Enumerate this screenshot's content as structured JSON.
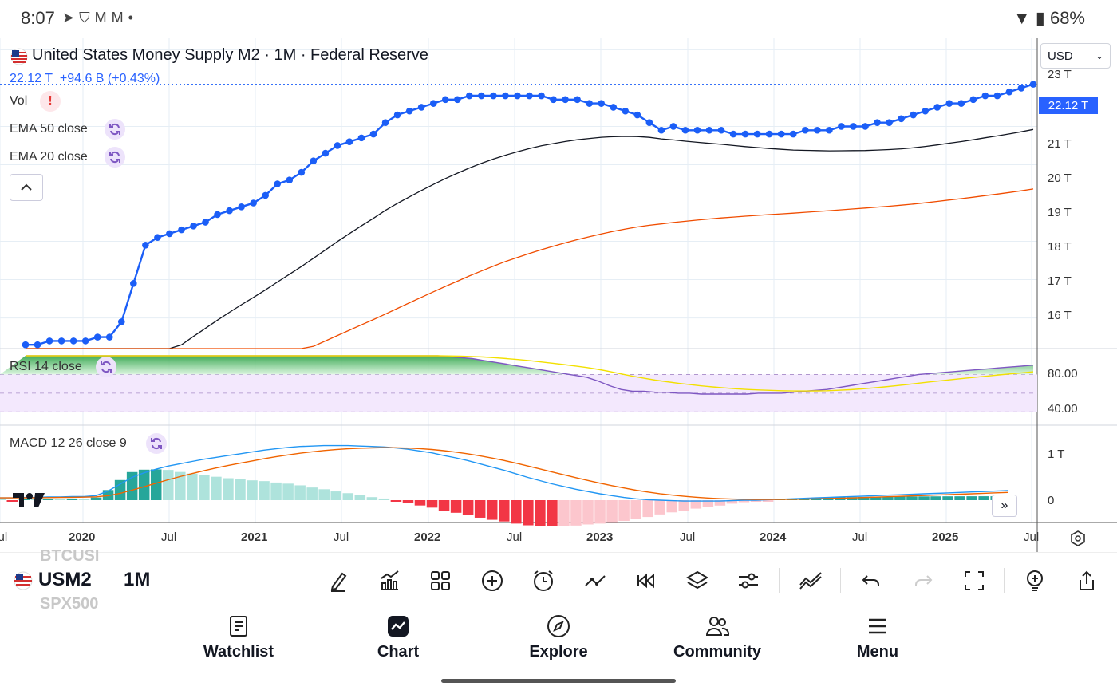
{
  "status_bar": {
    "time": "8:07",
    "battery": "68%",
    "icons": [
      "telegram-icon",
      "brave-icon",
      "gmail-icon",
      "medium-icon",
      "dot-icon"
    ],
    "right_icons": [
      "wifi-icon",
      "battery-icon"
    ]
  },
  "chart": {
    "title": "United States Money Supply M2 · 1M · Federal Reserve",
    "last_value": "22.12 T",
    "change": "+94.6 B (+0.43%)",
    "vol_label": "Vol",
    "ema50_label": "EMA 50 close",
    "ema20_label": "EMA 20 close",
    "rsi_label": "RSI 14 close",
    "macd_label": "MACD 12 26 close 9",
    "currency": "USD",
    "price_tag": "22.12 T",
    "price_axis": [
      "23 T",
      "21 T",
      "20 T",
      "19 T",
      "18 T",
      "17 T",
      "16 T"
    ],
    "rsi_axis": [
      "80.00",
      "40.00"
    ],
    "macd_axis": [
      "1 T",
      "0"
    ],
    "time_axis": [
      "Jul",
      "2020",
      "Jul",
      "2021",
      "Jul",
      "2022",
      "Jul",
      "2023",
      "Jul",
      "2024",
      "Jul",
      "2025",
      "Jul"
    ],
    "colors": {
      "m2": "#1b5ef7",
      "ema50": "#131722",
      "ema20": "#f04c00",
      "rsi": "#7e57c2",
      "rsi_ma": "#f2e000",
      "macd": "#2196f3",
      "signal": "#f06400",
      "hist_up": "#26a69a",
      "hist_down": "#f23645"
    }
  },
  "chart_data": {
    "type": "line",
    "x_start": "2019-07",
    "interval": "1M",
    "unit": "T USD",
    "series": [
      {
        "name": "United States Money Supply M2",
        "values": [
          15.3,
          15.3,
          15.4,
          15.4,
          15.4,
          15.4,
          15.5,
          15.5,
          15.9,
          16.9,
          17.9,
          18.1,
          18.2,
          18.3,
          18.4,
          18.5,
          18.7,
          18.8,
          18.9,
          19.0,
          19.2,
          19.5,
          19.6,
          19.8,
          20.1,
          20.3,
          20.5,
          20.6,
          20.7,
          20.8,
          21.1,
          21.3,
          21.4,
          21.5,
          21.6,
          21.7,
          21.7,
          21.8,
          21.8,
          21.8,
          21.8,
          21.8,
          21.8,
          21.8,
          21.7,
          21.7,
          21.7,
          21.6,
          21.6,
          21.5,
          21.4,
          21.3,
          21.1,
          20.9,
          21.0,
          20.9,
          20.9,
          20.9,
          20.9,
          20.8,
          20.8,
          20.8,
          20.8,
          20.8,
          20.8,
          20.9,
          20.9,
          20.9,
          21.0,
          21.0,
          21.0,
          21.1,
          21.1,
          21.2,
          21.3,
          21.4,
          21.5,
          21.6,
          21.6,
          21.7,
          21.8,
          21.8,
          21.9,
          22.0,
          22.1
        ]
      }
    ],
    "rsi_series": [
      {
        "values": [
          100,
          100,
          100,
          100,
          100,
          100,
          100,
          100,
          100,
          100,
          100,
          100,
          100,
          100,
          100,
          100,
          100,
          100,
          100,
          100,
          100,
          100,
          100,
          100,
          100,
          100,
          100,
          100,
          100,
          100,
          100,
          100,
          100,
          100,
          100,
          100,
          100,
          99,
          98,
          97,
          95,
          93,
          91,
          89,
          87,
          85,
          83,
          81,
          79,
          77,
          73,
          68,
          64,
          62,
          62,
          61,
          61,
          60,
          60,
          59,
          59,
          59,
          59,
          59,
          60,
          60,
          60,
          61,
          62,
          63,
          64,
          66,
          68,
          70,
          72,
          74,
          76,
          78,
          80,
          81,
          82,
          83,
          84,
          85,
          86,
          87,
          88,
          89,
          90
        ]
      }
    ],
    "macd_series": [
      {
        "values": [
          0.05,
          0.05,
          0.06,
          0.06,
          0.07,
          0.07,
          0.08,
          0.08,
          0.1,
          0.2,
          0.35,
          0.5,
          0.6,
          0.68,
          0.75,
          0.8,
          0.85,
          0.9,
          0.94,
          0.98,
          1.02,
          1.06,
          1.1,
          1.13,
          1.16,
          1.18,
          1.19,
          1.2,
          1.2,
          1.2,
          1.19,
          1.18,
          1.17,
          1.15,
          1.12,
          1.08,
          1.04,
          0.98,
          0.93,
          0.87,
          0.8,
          0.73,
          0.66,
          0.58,
          0.5,
          0.43,
          0.36,
          0.3,
          0.24,
          0.19,
          0.14,
          0.1,
          0.06,
          0.03,
          0.01,
          0.0,
          -0.01,
          -0.02,
          -0.02,
          -0.02,
          -0.02,
          -0.01,
          0.0,
          0.0,
          0.01,
          0.02,
          0.03,
          0.04,
          0.05,
          0.06,
          0.07,
          0.08,
          0.09,
          0.1,
          0.11,
          0.12,
          0.13,
          0.14,
          0.15,
          0.16,
          0.17,
          0.18,
          0.19,
          0.2,
          0.21
        ]
      }
    ],
    "ylim": [
      15.2,
      23.3
    ],
    "rsi_ylim": [
      30,
      100
    ],
    "grid": true
  },
  "toolbar": {
    "symbol": "USM2",
    "interval": "1M",
    "ghost_above": "BTCUSI",
    "ghost_below": "SPX500",
    "icons": [
      "pencil-icon",
      "indicators-icon",
      "layout-grid-icon",
      "add-icon",
      "alert-icon",
      "drawing-tools-icon",
      "replay-icon",
      "layers-icon",
      "settings-sliders-icon",
      "compare-icon",
      "undo-icon",
      "redo-icon",
      "fullscreen-icon",
      "idea-icon",
      "share-icon"
    ]
  },
  "bottom_nav": [
    {
      "label": "Watchlist",
      "icon": "watchlist-icon"
    },
    {
      "label": "Chart",
      "icon": "chart-icon"
    },
    {
      "label": "Explore",
      "icon": "compass-icon"
    },
    {
      "label": "Community",
      "icon": "community-icon"
    },
    {
      "label": "Menu",
      "icon": "menu-icon"
    }
  ]
}
